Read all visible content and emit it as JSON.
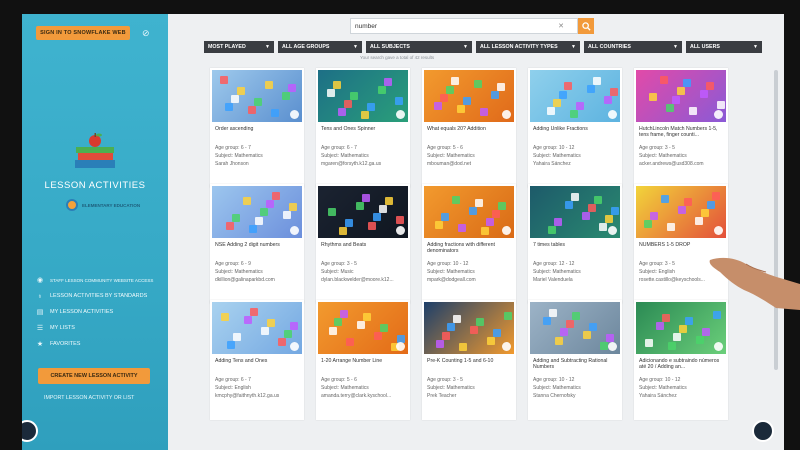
{
  "sidebar": {
    "sign_in_label": "SIGN IN TO SNOWFLAKE WEB",
    "title": "LESSON ACTIVITIES",
    "badge_text": "ELEMENTARY EDUCATION",
    "nav": [
      {
        "label": "STAFF LESSON COMMUNITY WEBSITE ACCESS",
        "icon": "community-icon"
      },
      {
        "label": "LESSON ACTIVITIES BY STANDARDS",
        "icon": "standards-icon"
      },
      {
        "label": "MY LESSON ACTIVITIES",
        "icon": "document-icon"
      },
      {
        "label": "MY LISTS",
        "icon": "list-icon"
      },
      {
        "label": "FAVORITES",
        "icon": "star-icon"
      }
    ],
    "create_label": "CREATE NEW LESSON ACTIVITY",
    "import_label": "IMPORT LESSON ACTIVITY OR LIST"
  },
  "search": {
    "value": "number",
    "placeholder": "Search"
  },
  "filters": [
    "MOST PLAYED",
    "ALL AGE GROUPS",
    "ALL SUBJECTS",
    "ALL LESSON ACTIVITY TYPES",
    "ALL COUNTRIES",
    "ALL USERS"
  ],
  "results_note": "Your search gave a total of 42 results",
  "cards": [
    {
      "title": "Order ascending",
      "age": "Age group: 6 - 7",
      "subject": "Subject: Mathematics",
      "author": "Sarah Jhonson",
      "bg": "#9ec9ec",
      "bg2": "#5a8fcf"
    },
    {
      "title": "Tens and Ones Spinner",
      "age": "Age group: 6 - 7",
      "subject": "Subject: Mathematics",
      "author": "mgaren@forsyth.k12.ga.us",
      "bg": "#1d6f86",
      "bg2": "#2a9f7a"
    },
    {
      "title": "What equals 20? Addition",
      "age": "Age group: 5 - 6",
      "subject": "Subject: Mathematics",
      "author": "mbouman@dod.net",
      "bg": "#f29a2e",
      "bg2": "#e06a1a"
    },
    {
      "title": "Adding Unlike Fractions",
      "age": "Age group: 10 - 12",
      "subject": "Subject: Mathematics",
      "author": "Yahaira Sánchez",
      "bg": "#8fd0ec",
      "bg2": "#5db3e0"
    },
    {
      "title": "HutchLincoln Match Numbers 1-5, tens frame, finger counti...",
      "age": "Age group: 3 - 5",
      "subject": "Subject: Mathematics",
      "author": "acker.andrews@usd308.com",
      "bg": "#e24aa8",
      "bg2": "#8a5ad6"
    },
    {
      "title": "NSE Adding 2 digit numbers",
      "age": "Age group: 6 - 9",
      "subject": "Subject: Mathematics",
      "author": "dkillion@galinaparkbd.com",
      "bg": "#9cc6ee",
      "bg2": "#6c8fdc"
    },
    {
      "title": "Rhythms and Beats",
      "age": "Age group: 3 - 5",
      "subject": "Subject: Music",
      "author": "dylan.blackwelder@moore.k12...",
      "bg": "#1b2331",
      "bg2": "#0f1620"
    },
    {
      "title": "Adding fractions with different denominators",
      "age": "Age group: 10 - 12",
      "subject": "Subject: Mathematics",
      "author": "mpark@dodgeall.com",
      "bg": "#f29a2e",
      "bg2": "#d96a16"
    },
    {
      "title": "7 times tables",
      "age": "Age group: 12 - 12",
      "subject": "Subject: Mathematics",
      "author": "Mariel Valenduela",
      "bg": "#1d5a6a",
      "bg2": "#2a8a70"
    },
    {
      "title": "NUMBERS 1-5 DROP",
      "age": "Age group: 3 - 5",
      "subject": "Subject: English",
      "author": "rosette.castillo@keyschools...",
      "bg": "#f2d43a",
      "bg2": "#e34f3a"
    },
    {
      "title": "Adding Tens and Ones",
      "age": "Age group: 6 - 7",
      "subject": "Subject: English",
      "author": "kmcphy@faithnyth.k12.ga.us",
      "bg": "#a9d2ef",
      "bg2": "#74a8e2"
    },
    {
      "title": "1-20 Arrange Number Line",
      "age": "Age group: 5 - 6",
      "subject": "Subject: Mathematics",
      "author": "amanda.terry@clark.kyschool...",
      "bg": "#f29a2e",
      "bg2": "#e36b18"
    },
    {
      "title": "Pre-K Counting 1-5 and 6-10",
      "age": "Age group: 3 - 5",
      "subject": "Subject: Mathematics",
      "author": "Prek Teacher",
      "bg": "#1d3f6a",
      "bg2": "#f29a2e"
    },
    {
      "title": "Adding and Subtracting Rational Numbers",
      "age": "Age group: 10 - 12",
      "subject": "Subject: Mathematics",
      "author": "Stanna Chernofsky",
      "bg": "#9cb3c7",
      "bg2": "#6d879d"
    },
    {
      "title": "Adicionando e subtraindo números até 20 / Adding an...",
      "age": "Age group: 10 - 12",
      "subject": "Subject: Mathematics",
      "author": "Yahaira Sánchez",
      "bg": "#2b8a54",
      "bg2": "#6bcf7a"
    }
  ],
  "colors": {
    "accent": "#f29a3b",
    "sidebar": "#3fb3cf",
    "filter_bg": "#3a3d42"
  }
}
